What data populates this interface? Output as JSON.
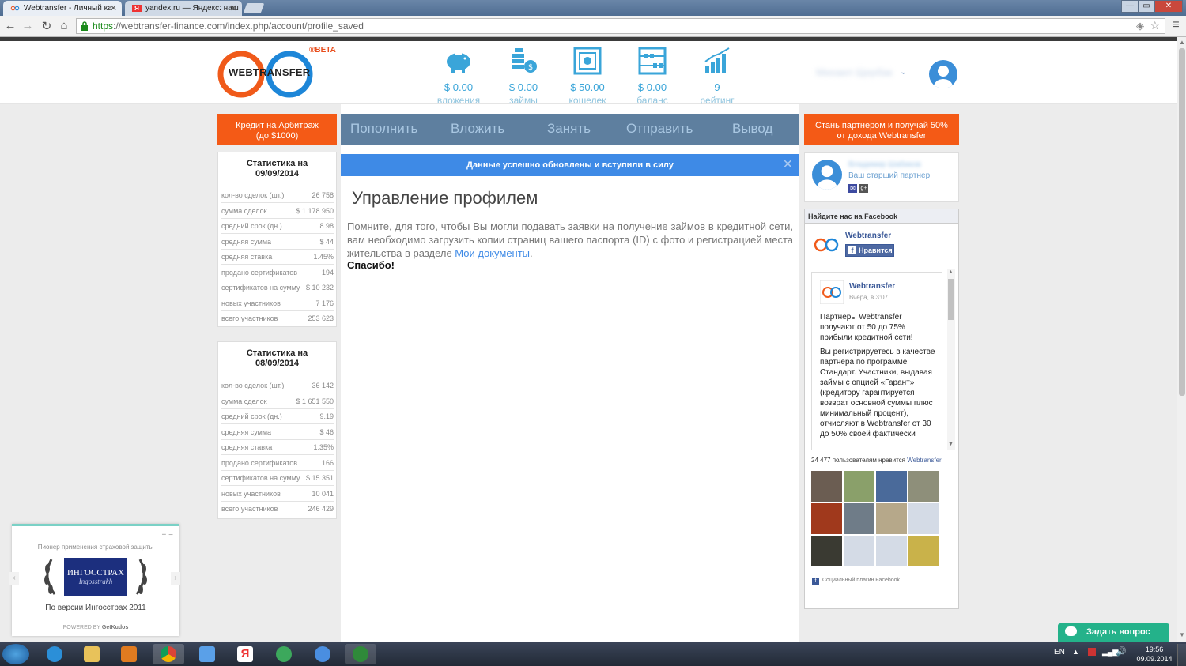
{
  "browser": {
    "tabs": [
      {
        "title": "Webtransfer - Личный ка"
      },
      {
        "title": "yandex.ru — Яндекс: наш"
      }
    ],
    "url_scheme": "https",
    "url_rest": "://webtransfer-finance.com/index.php/account/profile_saved",
    "window_buttons": [
      "—",
      "▭",
      "✕"
    ]
  },
  "header": {
    "logo_text": "WEBTRANSFER",
    "logo_badge": "®BETA",
    "stats": [
      {
        "value": "$ 0.00",
        "label": "вложения",
        "icon": "piggy-bank-icon"
      },
      {
        "value": "$ 0.00",
        "label": "займы",
        "icon": "coins-icon"
      },
      {
        "value": "$ 50.00",
        "label": "кошелек",
        "icon": "safe-icon"
      },
      {
        "value": "$ 0.00",
        "label": "баланс",
        "icon": "abacus-icon"
      },
      {
        "value": "9",
        "label": "рейтинг",
        "icon": "rating-chart-icon"
      }
    ],
    "username": "Михаил Щербак"
  },
  "left_button": {
    "line1": "Кредит на Арбитраж",
    "line2": "(до $1000)"
  },
  "nav": [
    "Пополнить",
    "Вложить",
    "Занять",
    "Отправить",
    "Вывод"
  ],
  "right_button": {
    "line1": "Стань партнером и получай 50%",
    "line2": "от дохода Webtransfer"
  },
  "stats_boxes": [
    {
      "title": "Статистика на 09/09/2014",
      "rows": [
        {
          "k": "кол-во сделок (шт.)",
          "v": "26 758"
        },
        {
          "k": "сумма сделок",
          "v": "$ 1 178 950"
        },
        {
          "k": "средний срок (дн.)",
          "v": "8.98"
        },
        {
          "k": "средняя сумма",
          "v": "$ 44"
        },
        {
          "k": "средняя ставка",
          "v": "1.45%"
        },
        {
          "k": "продано сертификатов",
          "v": "194"
        },
        {
          "k": "сертификатов на сумму",
          "v": "$ 10 232"
        },
        {
          "k": "новых участников",
          "v": "7 176"
        },
        {
          "k": "всего участников",
          "v": "253 623"
        }
      ]
    },
    {
      "title": "Статистика на 08/09/2014",
      "rows": [
        {
          "k": "кол-во сделок (шт.)",
          "v": "36 142"
        },
        {
          "k": "сумма сделок",
          "v": "$ 1 651 550"
        },
        {
          "k": "средний срок (дн.)",
          "v": "9.19"
        },
        {
          "k": "средняя сумма",
          "v": "$ 46"
        },
        {
          "k": "средняя ставка",
          "v": "1.35%"
        },
        {
          "k": "продано сертификатов",
          "v": "166"
        },
        {
          "k": "сертификатов на сумму",
          "v": "$ 15 351"
        },
        {
          "k": "новых участников",
          "v": "10 041"
        },
        {
          "k": "всего участников",
          "v": "246 429"
        }
      ]
    }
  ],
  "main": {
    "alert": "Данные успешно обновлены и вступили в силу",
    "title": "Управление профилем",
    "text_before_link": "Помните, для того, чтобы Вы могли подавать заявки на получение займов в кредитной сети, вам необходимо загрузить копии страниц вашего паспорта (ID) с фото и регистрацией места жительства в разделе ",
    "link": "Мои документы",
    "text_after_link": ".",
    "thanks": "Спасибо!"
  },
  "partner": {
    "name": "Владимир Шабиков",
    "role": "Ваш старший партнер"
  },
  "facebook": {
    "header": "Найдите нас на Facebook",
    "page_name": "Webtransfer",
    "like_label": "Нравится",
    "post_author": "Webtransfer",
    "post_time": "Вчера, в 3:07",
    "post_p1": "Партнеры Webtransfer получают от 50 до 75% прибыли кредитной сети!",
    "post_p2": "Вы регистрируетесь в качестве партнера по программе Стандарт. Участники, выдавая займы с опцией «Гарант» (кредитору гарантируется возврат основной суммы плюс минимальный процент), отчисляют в Webtransfer от 30 до 50% своей фактически",
    "likes_text": "24 477 пользователям нравится",
    "likes_link": "Webtransfer.",
    "plugin_text": "Социальный плагин Facebook",
    "faces": 12
  },
  "ingo": {
    "caption": "Пионер применения страховой защиты",
    "brand": "ИНГОССТРАХ",
    "brand_script": "Ingosstrakh",
    "version": "По версии Ингосстрах 2011",
    "powered": "POWERED BY",
    "powered_brand": "GetKudos",
    "controls": "+ −"
  },
  "help": {
    "label": "Задать вопрос"
  },
  "taskbar": {
    "lang": "EN",
    "time": "19:56",
    "date": "09.09.2014"
  },
  "colors": {
    "orange": "#f45a16",
    "nav": "#5e7f9f",
    "accent": "#3aa5d9",
    "alert": "#3e8ae6"
  }
}
